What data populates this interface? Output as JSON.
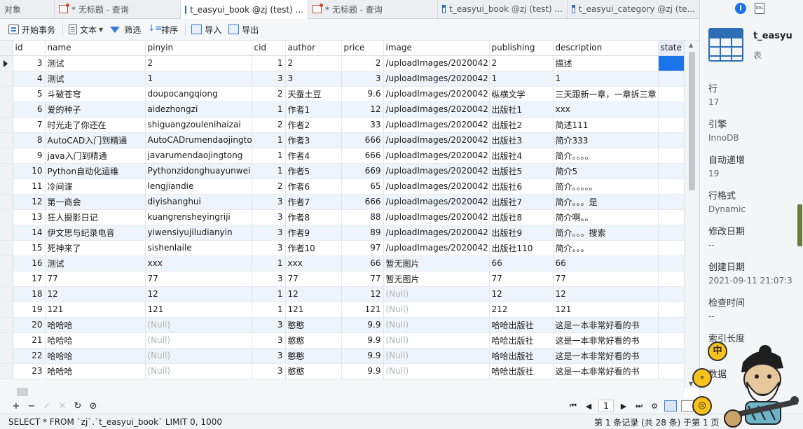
{
  "tabs": [
    {
      "label": "对象",
      "icon": "none",
      "active": false
    },
    {
      "label": "* 无标题 - 查询",
      "icon": "query-icon",
      "active": false
    },
    {
      "label": "t_easyui_book @zj (test) ...",
      "icon": "table-icon",
      "active": true
    },
    {
      "label": "* 无标题 - 查询",
      "icon": "query-icon",
      "active": false
    },
    {
      "label": "t_easyui_book @zj (test) ...",
      "icon": "table-icon",
      "active": false
    },
    {
      "label": "t_easyui_category @zj (te...",
      "icon": "table-icon",
      "active": false
    }
  ],
  "toolbar": {
    "begin_tx": "开始事务",
    "text": "文本",
    "filter": "筛选",
    "sort": "排序",
    "import": "导入",
    "export": "导出"
  },
  "grid": {
    "columns": [
      "id",
      "name",
      "pinyin",
      "cid",
      "author",
      "price",
      "image",
      "publishing",
      "description",
      "state"
    ],
    "rows": [
      [
        "3",
        "测试",
        "2",
        "1",
        "2",
        "2",
        "/uploadImages/2020042",
        "2",
        "描述",
        ""
      ],
      [
        "4",
        "测试",
        "1",
        "3",
        "3",
        "3",
        "/uploadImages/2020042",
        "1",
        "1",
        ""
      ],
      [
        "5",
        "斗破苍穹",
        "doupocangqiong",
        "2",
        "天蚕土豆",
        "9.6",
        "/uploadImages/2020042",
        "纵横文学",
        "三天跟新一章，一章拆三章",
        ""
      ],
      [
        "6",
        "爱的种子",
        "aidezhongzi",
        "1",
        "作者1",
        "12",
        "/uploadImages/2020042",
        "出版社1",
        "xxx",
        ""
      ],
      [
        "7",
        "时光走了你还在",
        "shiguangzoulenihaizai",
        "2",
        "作者2",
        "33",
        "/uploadImages/2020042",
        "出版社2",
        "简述111",
        ""
      ],
      [
        "8",
        "AutoCAD入门到精通",
        "AutoCADrumendaojingtong",
        "1",
        "作者3",
        "666",
        "/uploadImages/2020042",
        "出版社3",
        "简介333",
        ""
      ],
      [
        "9",
        "java入门到精通",
        "javarumendaojingtong",
        "1",
        "作者4",
        "666",
        "/uploadImages/2020042",
        "出版社4",
        "简介。。。。",
        ""
      ],
      [
        "10",
        "Python自动化运维",
        "Pythonzidonghuayunwei",
        "1",
        "作者5",
        "669",
        "/uploadImages/2020042",
        "出版社5",
        "简介5",
        ""
      ],
      [
        "11",
        "冷间谍",
        "lengjiandie",
        "2",
        "作者6",
        "65",
        "/uploadImages/2020042",
        "出版社6",
        "简介。。。。。",
        ""
      ],
      [
        "12",
        "第一商会",
        "diyishanghui",
        "3",
        "作者7",
        "666",
        "/uploadImages/2020042",
        "出版社7",
        "简介。。。是",
        ""
      ],
      [
        "13",
        "狂人摄影日记",
        "kuangrensheyingriji",
        "3",
        "作者8",
        "88",
        "/uploadImages/2020042",
        "出版社8",
        "简介啊。。",
        ""
      ],
      [
        "14",
        "伊文思与纪录电音",
        "yiwensiyujiludianyin",
        "3",
        "作者9",
        "89",
        "/uploadImages/2020042",
        "出版社9",
        "简介。。。搜索",
        ""
      ],
      [
        "15",
        "死神来了",
        "sishenlaile",
        "3",
        "作者10",
        "97",
        "/uploadImages/2020042",
        "出版社110",
        "简介。。。",
        ""
      ],
      [
        "16",
        "测试",
        "xxx",
        "1",
        "xxx",
        "66",
        "暂无图片",
        "66",
        "66",
        ""
      ],
      [
        "17",
        "77",
        "77",
        "3",
        "77",
        "77",
        "暂无图片",
        "77",
        "77",
        ""
      ],
      [
        "18",
        "12",
        "12",
        "1",
        "12",
        "12",
        "(Null)",
        "12",
        "12",
        ""
      ],
      [
        "19",
        "121",
        "121",
        "1",
        "121",
        "121",
        "(Null)",
        "212",
        "121",
        ""
      ],
      [
        "20",
        "哈哈哈",
        "(Null)",
        "3",
        "憨憨",
        "9.9",
        "(Null)",
        "哈哈出版社",
        "这是一本非常好看的书",
        ""
      ],
      [
        "21",
        "哈哈哈",
        "(Null)",
        "3",
        "憨憨",
        "9.9",
        "(Null)",
        "哈哈出版社",
        "这是一本非常好看的书",
        ""
      ],
      [
        "22",
        "哈哈哈",
        "(Null)",
        "3",
        "憨憨",
        "9.9",
        "(Null)",
        "哈哈出版社",
        "这是一本非常好看的书",
        ""
      ],
      [
        "23",
        "哈哈哈",
        "(Null)",
        "3",
        "憨憨",
        "9.9",
        "(Null)",
        "哈哈出版社",
        "这是一本非常好看的书",
        ""
      ]
    ]
  },
  "bottombar": {
    "add": "+",
    "remove": "−",
    "apply": "✓",
    "discard": "✕",
    "refresh": "↻",
    "stop": "⊘",
    "page": "1"
  },
  "statusbar": {
    "sql": "SELECT * FROM `zj`.`t_easyui_book` LIMIT 0, 1000",
    "record": "第 1 条记录 (共 28 条) 于第 1 页"
  },
  "panel": {
    "table_name": "t_easyu",
    "table_kind": "表",
    "props": [
      {
        "k": "行",
        "v": "17"
      },
      {
        "k": "引擎",
        "v": "InnoDB"
      },
      {
        "k": "自动递增",
        "v": "19"
      },
      {
        "k": "行格式",
        "v": "Dynamic"
      },
      {
        "k": "修改日期",
        "v": "--"
      },
      {
        "k": "创建日期",
        "v": "2021-09-11 21:07:3"
      },
      {
        "k": "检查时间",
        "v": "--"
      },
      {
        "k": "索引长度",
        "v": ""
      },
      {
        "k": "数据",
        "v": ""
      }
    ],
    "badge": "中"
  },
  "colors": {
    "accent": "#1a73e8",
    "alt_row": "#eef4fb",
    "null_text": "#b0b4ba"
  }
}
